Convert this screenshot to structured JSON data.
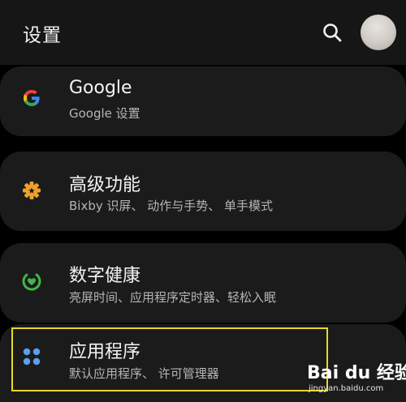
{
  "header": {
    "title": "设置"
  },
  "items": [
    {
      "title": "Google",
      "subtitle": "Google 设置",
      "icon": "google-g-icon"
    },
    {
      "title": "高级功能",
      "subtitle": "Bixby 识屏、 动作与手势、 单手模式",
      "icon": "advanced-features-gear-icon",
      "icon_color": "#f0a02a"
    },
    {
      "title": "数字健康",
      "subtitle": "亮屏时间、应用程序定时器、轻松入眠",
      "icon": "digital-wellbeing-icon",
      "icon_color": "#43b649"
    },
    {
      "title": "应用程序",
      "subtitle": "默认应用程序、 许可管理器",
      "icon": "apps-grid-icon",
      "icon_color": "#5c9ff0",
      "highlighted": true
    }
  ],
  "watermark": {
    "logo": "Bai du 经验",
    "url": "jingyan.baidu.com"
  },
  "colors": {
    "background": "#000000",
    "card": "#1b1b1b",
    "highlight": "#ead62a"
  }
}
